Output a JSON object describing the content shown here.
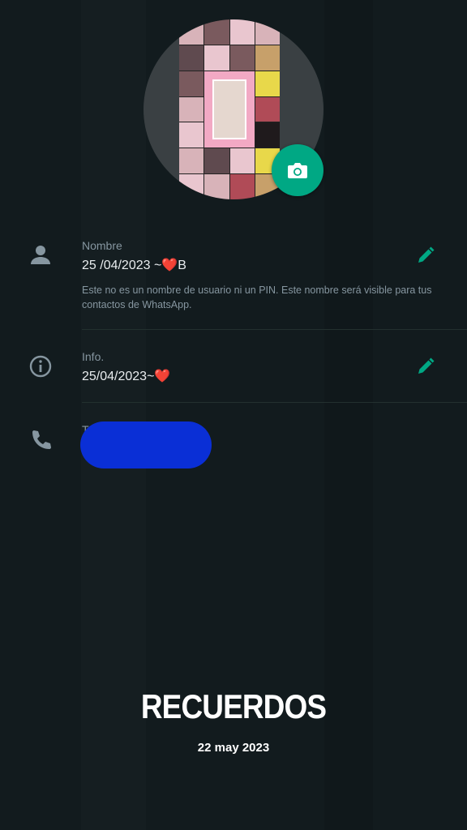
{
  "profile": {
    "photo_icon": "profile-photo-collage",
    "camera_icon": "camera-icon",
    "accent_color": "#00a884"
  },
  "name_row": {
    "icon": "person-icon",
    "label": "Nombre",
    "value": "25 /04/2023 ~❤️B",
    "note": "Este no es un nombre de usuario ni un PIN. Este nombre será visible para tus contactos de WhatsApp.",
    "edit_icon": "pencil-icon"
  },
  "info_row": {
    "icon": "info-icon",
    "label": "Info.",
    "value": "25/04/2023~❤️",
    "edit_icon": "pencil-icon"
  },
  "phone_row": {
    "icon": "phone-icon",
    "label": "Teléfono",
    "redaction_color": "#0a2fd6"
  },
  "overlay": {
    "title": "RECUERDOS",
    "date": "22 may 2023"
  }
}
